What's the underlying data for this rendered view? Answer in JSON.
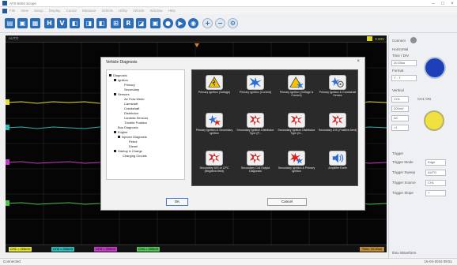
{
  "window": {
    "title": "ATS-5004 Scope",
    "controls": [
      "–",
      "□",
      "×"
    ]
  },
  "menu": [
    "File",
    "View",
    "Setup",
    "Display",
    "Cursor",
    "Measure",
    "Vehicle",
    "Utility",
    "Vehicle",
    "Window",
    "Help"
  ],
  "scope": {
    "mode": "AUTO",
    "top_channel_value": "0.00V",
    "channels": [
      {
        "label": "CH1 = 200mV",
        "color": "#e2e22e"
      },
      {
        "label": "CH2 = 200mV",
        "color": "#2fb8b8"
      },
      {
        "label": "CH3 = 200mV",
        "color": "#c43cc4"
      },
      {
        "label": "CH4 = 200mV",
        "color": "#4fc34f"
      }
    ],
    "timebase": "Time: 20.00us"
  },
  "right_panel": {
    "connect_label": "Connect",
    "horizontal_label": "Horizontal",
    "time_div_label": "Time / DIV",
    "time_div_value": "20.00us",
    "format_label": "Format",
    "format_value": "Y - T",
    "vertical_label": "Vertical",
    "vertical_channel": "CH1",
    "vertical_on": "CH1 ON",
    "volts_div": "200mV",
    "coupling": "AC",
    "probe": "×1",
    "trigger_label": "Trigger",
    "trigger_mode_label": "Trigger Mode",
    "trigger_mode_value": "Edge",
    "trigger_sweep_label": "Trigger Sweep",
    "trigger_sweep_value": "AUTO",
    "trigger_source_label": "Trigger Source",
    "trigger_source_value": "CH1",
    "trigger_slope_label": "Trigger Slope",
    "trigger_slope_value": "+"
  },
  "status": {
    "left": "Connected",
    "right_top": "Ibnu Waveform",
    "right": "16-04-2016 09:51"
  },
  "dialog": {
    "title": "Vehicle Diagnosis",
    "close": "×",
    "tree": [
      {
        "level": 0,
        "text": "Diagnosis"
      },
      {
        "level": 1,
        "text": "Ignition"
      },
      {
        "level": 2,
        "text": "Primary"
      },
      {
        "level": 2,
        "text": "Secondary"
      },
      {
        "level": 1,
        "text": "Sensors"
      },
      {
        "level": 2,
        "text": "Air Flow Meter"
      },
      {
        "level": 2,
        "text": "Camshaft"
      },
      {
        "level": 2,
        "text": "Crankshaft"
      },
      {
        "level": 2,
        "text": "Distributor"
      },
      {
        "level": 2,
        "text": "Lambda Sensors"
      },
      {
        "level": 2,
        "text": "Throttle Position"
      },
      {
        "level": 1,
        "text": "Bus Diagnosis"
      },
      {
        "level": 1,
        "text": "Engine"
      },
      {
        "level": 2,
        "text": "Injector Diagnosis"
      },
      {
        "level": 3,
        "text": "Petrol"
      },
      {
        "level": 3,
        "text": "Diesel"
      },
      {
        "level": 1,
        "text": "Startup & Charge"
      },
      {
        "level": 2,
        "text": "Charging Circuits"
      }
    ],
    "tiles": [
      {
        "label": "Primary Ignition (Voltage)",
        "icon": "warning-ignition-icon"
      },
      {
        "label": "Primary Ignition (Current)",
        "icon": "spark-icon"
      },
      {
        "label": "Primary Ignition (Voltage & Current)",
        "icon": "warning-ignition-icon"
      },
      {
        "label": "Primary Ignition & Crankshaft Sensor",
        "icon": "crankshaft-icon"
      },
      {
        "label": "Primary Ignition & Secondary Ignition",
        "icon": "spark-icon"
      },
      {
        "label": "Secondary Ignition Distributor Type (P...",
        "icon": "spark-icon"
      },
      {
        "label": "Secondary Ignition Distributor Type (N...",
        "icon": "spark-icon"
      },
      {
        "label": "Secondary DIS (Positive-fired)",
        "icon": "spark-icon"
      },
      {
        "label": "Secondary DIS or CPC (Negative-fired)",
        "icon": "spark-icon"
      },
      {
        "label": "Secondary Coil Output Diagnosis",
        "icon": "spark-icon"
      },
      {
        "label": "Secondary Ignition & Primary Ignition",
        "icon": "spark-icon"
      },
      {
        "label": "Amplifier Earth",
        "icon": "speaker-icon"
      }
    ],
    "ok": "OK",
    "cancel": "Cancel"
  }
}
